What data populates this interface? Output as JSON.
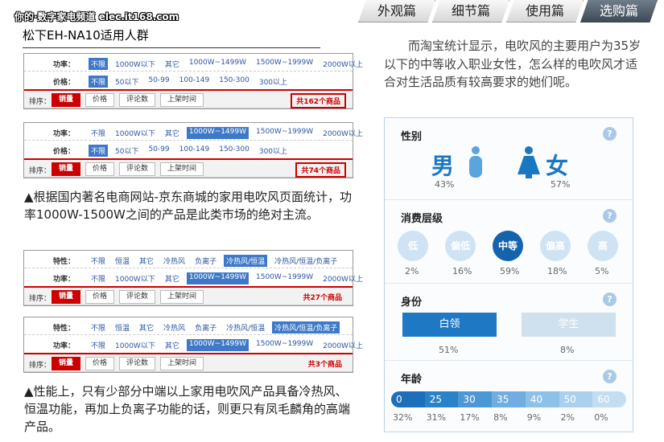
{
  "watermark": "你的·数字家电频道 elec.it168.com",
  "page_title": "松下EH-NA10适用人群",
  "tabs": [
    "外观篇",
    "细节篇",
    "使用篇",
    "选购篇"
  ],
  "panel1": {
    "rows": [
      {
        "label": "功率：",
        "options": [
          "不限",
          "1000W以下",
          "其它",
          "1000W~1499W",
          "1500W~1999W",
          "2000W以上"
        ],
        "selected": 0
      },
      {
        "label": "价格：",
        "options": [
          "不限",
          "50以下",
          "50-99",
          "100-149",
          "150-300",
          "300以上"
        ],
        "selected": 0
      }
    ],
    "sort_label": "排序：",
    "sort_buttons": [
      "销量",
      "价格",
      "评论数",
      "上架时间"
    ],
    "count": "共162个商品"
  },
  "panel2": {
    "rows": [
      {
        "label": "功率：",
        "options": [
          "不限",
          "1000W以下",
          "其它",
          "1000W~1499W",
          "1500W~1999W",
          "2000W以上"
        ],
        "selected": 3
      },
      {
        "label": "价格：",
        "options": [
          "不限",
          "50以下",
          "50-99",
          "100-149",
          "150-300",
          "300以上"
        ],
        "selected": 0
      }
    ],
    "sort_label": "排序：",
    "sort_buttons": [
      "销量",
      "价格",
      "评论数",
      "上架时间"
    ],
    "count": "共74个商品"
  },
  "caption1": "▲根据国内著名电商网站-京东商城的家用电吹风页面统计，功率1000W-1500W之间的产品是此类市场的绝对主流。",
  "panel3": {
    "rows": [
      {
        "label": "特性：",
        "options": [
          "不限",
          "恒温",
          "其它",
          "冷热风",
          "负离子",
          "冷热风/恒温",
          "冷热风/恒温/负离子"
        ],
        "selected": 5
      },
      {
        "label": "功率：",
        "options": [
          "不限",
          "1000W以下",
          "其它",
          "1000W~1499W",
          "1500W~1999W",
          "2000W以上"
        ],
        "selected": 3
      }
    ],
    "sort_label": "排序：",
    "sort_buttons": [
      "销量",
      "价格",
      "评论数",
      "上架时间"
    ],
    "count": "共27个商品"
  },
  "panel4": {
    "rows": [
      {
        "label": "特性：",
        "options": [
          "不限",
          "恒温",
          "其它",
          "冷热风",
          "负离子",
          "冷热风/恒温",
          "冷热风/恒温/负离子"
        ],
        "selected": 6
      },
      {
        "label": "功率：",
        "options": [
          "不限",
          "1000W以下",
          "其它",
          "1000W~1499W",
          "1500W~1999W",
          "2000W以上"
        ],
        "selected": 3
      }
    ],
    "sort_label": "排序：",
    "sort_buttons": [
      "销量",
      "价格",
      "评论数",
      "上架时间"
    ],
    "count": "共3个商品"
  },
  "caption2": "▲性能上，只有少部分中端以上家用电吹风产品具备冷热风、恒温功能，再加上负离子功能的话，则更只有凤毛麟角的高端产品。",
  "right_text": "而淘宝统计显示，电吹风的主要用户为35岁以下的中等收入职业女性，怎么样的电吹风才适合对生活品质有较高要求的她们呢。",
  "stats": {
    "help": "?",
    "gender": {
      "title": "性别",
      "male": "男",
      "female": "女",
      "male_pct": "43%",
      "female_pct": "57%"
    },
    "consumption": {
      "title": "消费层级",
      "levels": [
        "低",
        "偏低",
        "中等",
        "偏高",
        "高"
      ],
      "pcts": [
        "2%",
        "16%",
        "59%",
        "18%",
        "5%"
      ],
      "selected": 2
    },
    "identity": {
      "title": "身份",
      "options": [
        "白领",
        "学生"
      ],
      "pcts": [
        "51%",
        "8%"
      ],
      "selected": 0
    },
    "age": {
      "title": "年龄",
      "ticks": [
        "0",
        "25",
        "30",
        "35",
        "40",
        "50",
        "60"
      ],
      "pcts": [
        "32%",
        "31%",
        "17%",
        "8%",
        "9%",
        "2%",
        "0%"
      ],
      "colors": [
        "#1c6fb8",
        "#2a82c9",
        "#4d98d4",
        "#71ade0",
        "#8fc0e8",
        "#abd0ef",
        "#c3ddf3"
      ]
    }
  }
}
